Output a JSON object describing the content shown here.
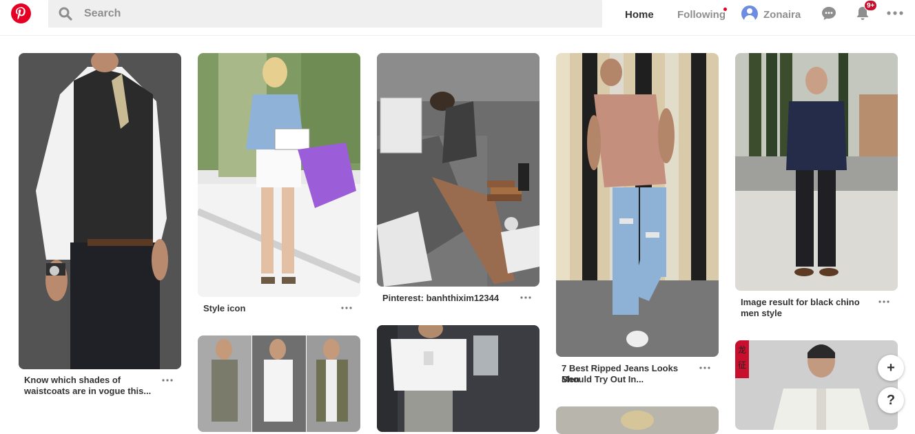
{
  "header": {
    "logo_icon": "pinterest-logo",
    "search_placeholder": "Search",
    "nav_home": "Home",
    "nav_following": "Following",
    "username": "Zonaira",
    "notifications_badge": "9+",
    "brand_color": "#e60023"
  },
  "pins": [
    {
      "title_line1": "Know which shades of",
      "title_line2": "waistcoats are in vogue this..."
    },
    {
      "title_line1": "Style icon",
      "title_line2": ""
    },
    {
      "title_line1": "Pinterest: banhthixim12344",
      "title_line2": ""
    },
    {
      "title_line1": "7 Best Ripped Jeans Looks Men",
      "title_line2": "Should Try Out In..."
    },
    {
      "title_line1": "Image result for black chino",
      "title_line2": "men style"
    }
  ],
  "floating": {
    "add_label": "+",
    "help_label": "?"
  }
}
